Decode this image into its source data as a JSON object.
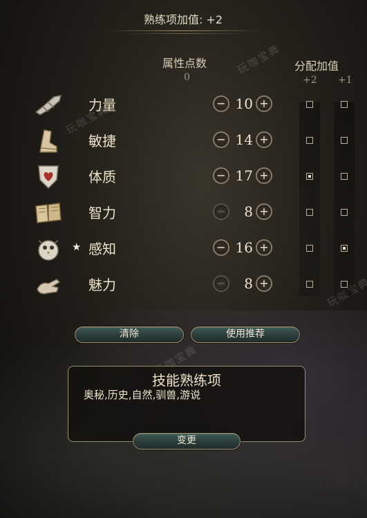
{
  "header": {
    "title": "熟练项加值: +2"
  },
  "columns": {
    "points_header": "属性点数",
    "points_remaining": "0",
    "bonus_header": "分配加值",
    "bonus_plus2": "+2",
    "bonus_plus1": "+1"
  },
  "attributes": [
    {
      "name": "力量",
      "value": "10",
      "icon": "gauntlet-icon",
      "starred": false,
      "minus_enabled": true,
      "plus_enabled": true,
      "plus2": false,
      "plus1": false
    },
    {
      "name": "敏捷",
      "value": "14",
      "icon": "boot-icon",
      "starred": false,
      "minus_enabled": true,
      "plus_enabled": true,
      "plus2": false,
      "plus1": false
    },
    {
      "name": "体质",
      "value": "17",
      "icon": "heart-shield-icon",
      "starred": false,
      "minus_enabled": true,
      "plus_enabled": true,
      "plus2": true,
      "plus1": false
    },
    {
      "name": "智力",
      "value": "8",
      "icon": "book-icon",
      "starred": false,
      "minus_enabled": false,
      "plus_enabled": true,
      "plus2": false,
      "plus1": false
    },
    {
      "name": "感知",
      "value": "16",
      "icon": "owl-icon",
      "starred": true,
      "minus_enabled": true,
      "plus_enabled": true,
      "plus2": false,
      "plus1": true
    },
    {
      "name": "魅力",
      "value": "8",
      "icon": "hand-icon",
      "starred": false,
      "minus_enabled": false,
      "plus_enabled": true,
      "plus2": false,
      "plus1": false
    }
  ],
  "star_symbol": "★",
  "minus_symbol": "−",
  "plus_symbol": "+",
  "buttons": {
    "clear": "清除",
    "recommend": "使用推荐",
    "change": "变更"
  },
  "skills": {
    "title": "技能熟练项",
    "list": "奥秘,历史,自然,驯兽,游说"
  },
  "watermark": "玩咖宝典"
}
